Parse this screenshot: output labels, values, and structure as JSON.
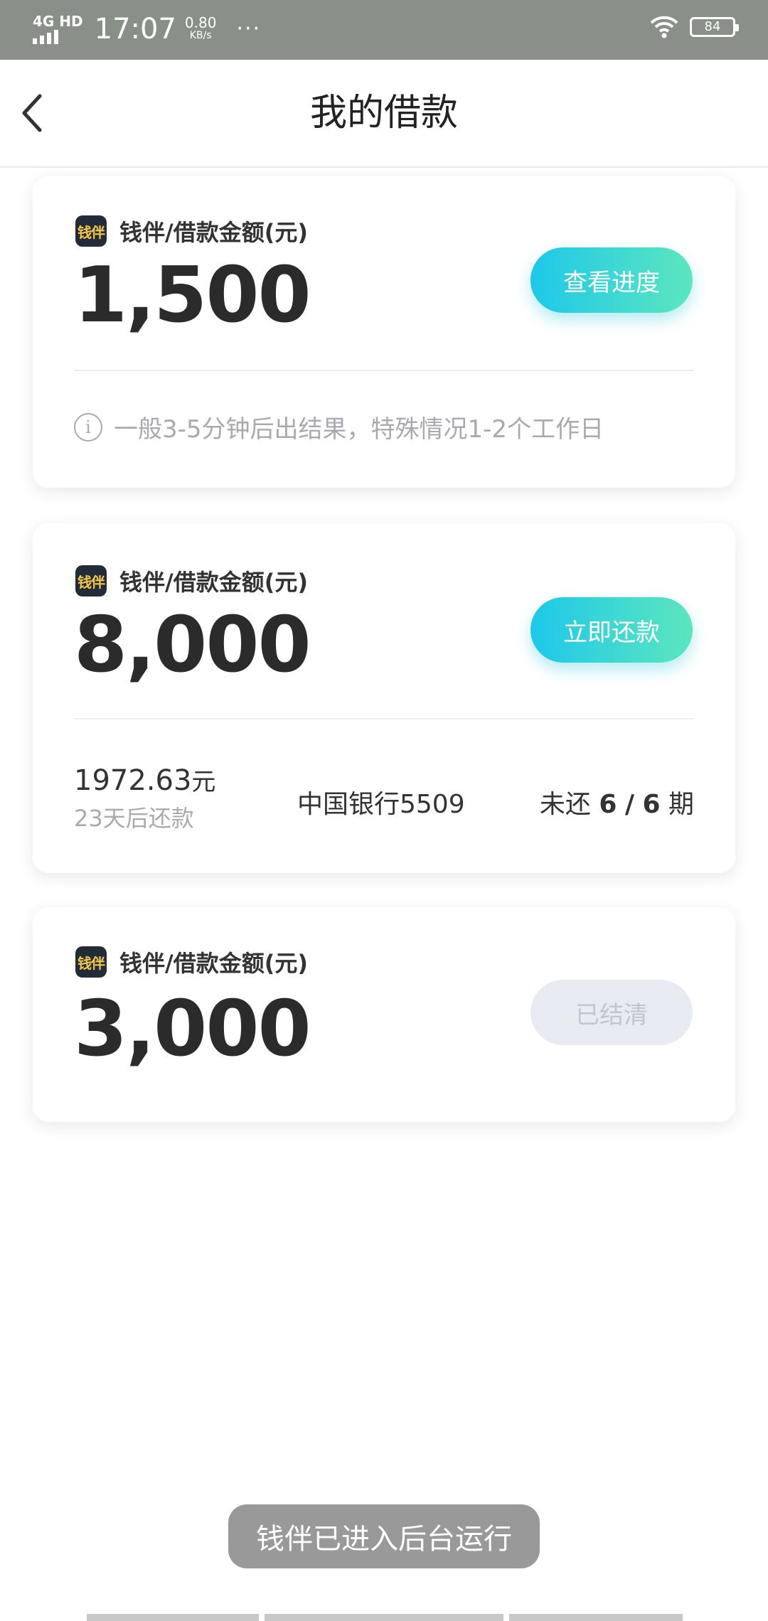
{
  "status_bar": {
    "network": "4G HD",
    "time": "17:07",
    "speed_value": "0.80",
    "speed_unit": "KB/s",
    "more": "···",
    "battery": "84"
  },
  "header": {
    "title": "我的借款"
  },
  "loans": [
    {
      "logo_text": "钱伴",
      "label": "钱伴/借款金额(元)",
      "amount": "1,500",
      "action": "查看进度",
      "note": "一般3-5分钟后出结果，特殊情况1-2个工作日"
    },
    {
      "logo_text": "钱伴",
      "label": "钱伴/借款金额(元)",
      "amount": "8,000",
      "action": "立即还款",
      "repay_amount": "1972.63",
      "repay_unit": "元",
      "repay_due": "23天后还款",
      "bank": "中国银行5509",
      "periods_prefix": "未还",
      "periods_remaining": "6",
      "periods_sep": "/",
      "periods_total": "6",
      "periods_suffix": "期"
    },
    {
      "logo_text": "钱伴",
      "label": "钱伴/借款金额(元)",
      "amount": "3,000",
      "action": "已结清"
    }
  ],
  "toast": "钱伴已进入后台运行",
  "colors": {
    "status_bar": "#8b8f8a",
    "button_gradient_start": "#1ec8ea",
    "button_gradient_end": "#5ce6bd",
    "disabled_button": "#e8ecf2"
  }
}
